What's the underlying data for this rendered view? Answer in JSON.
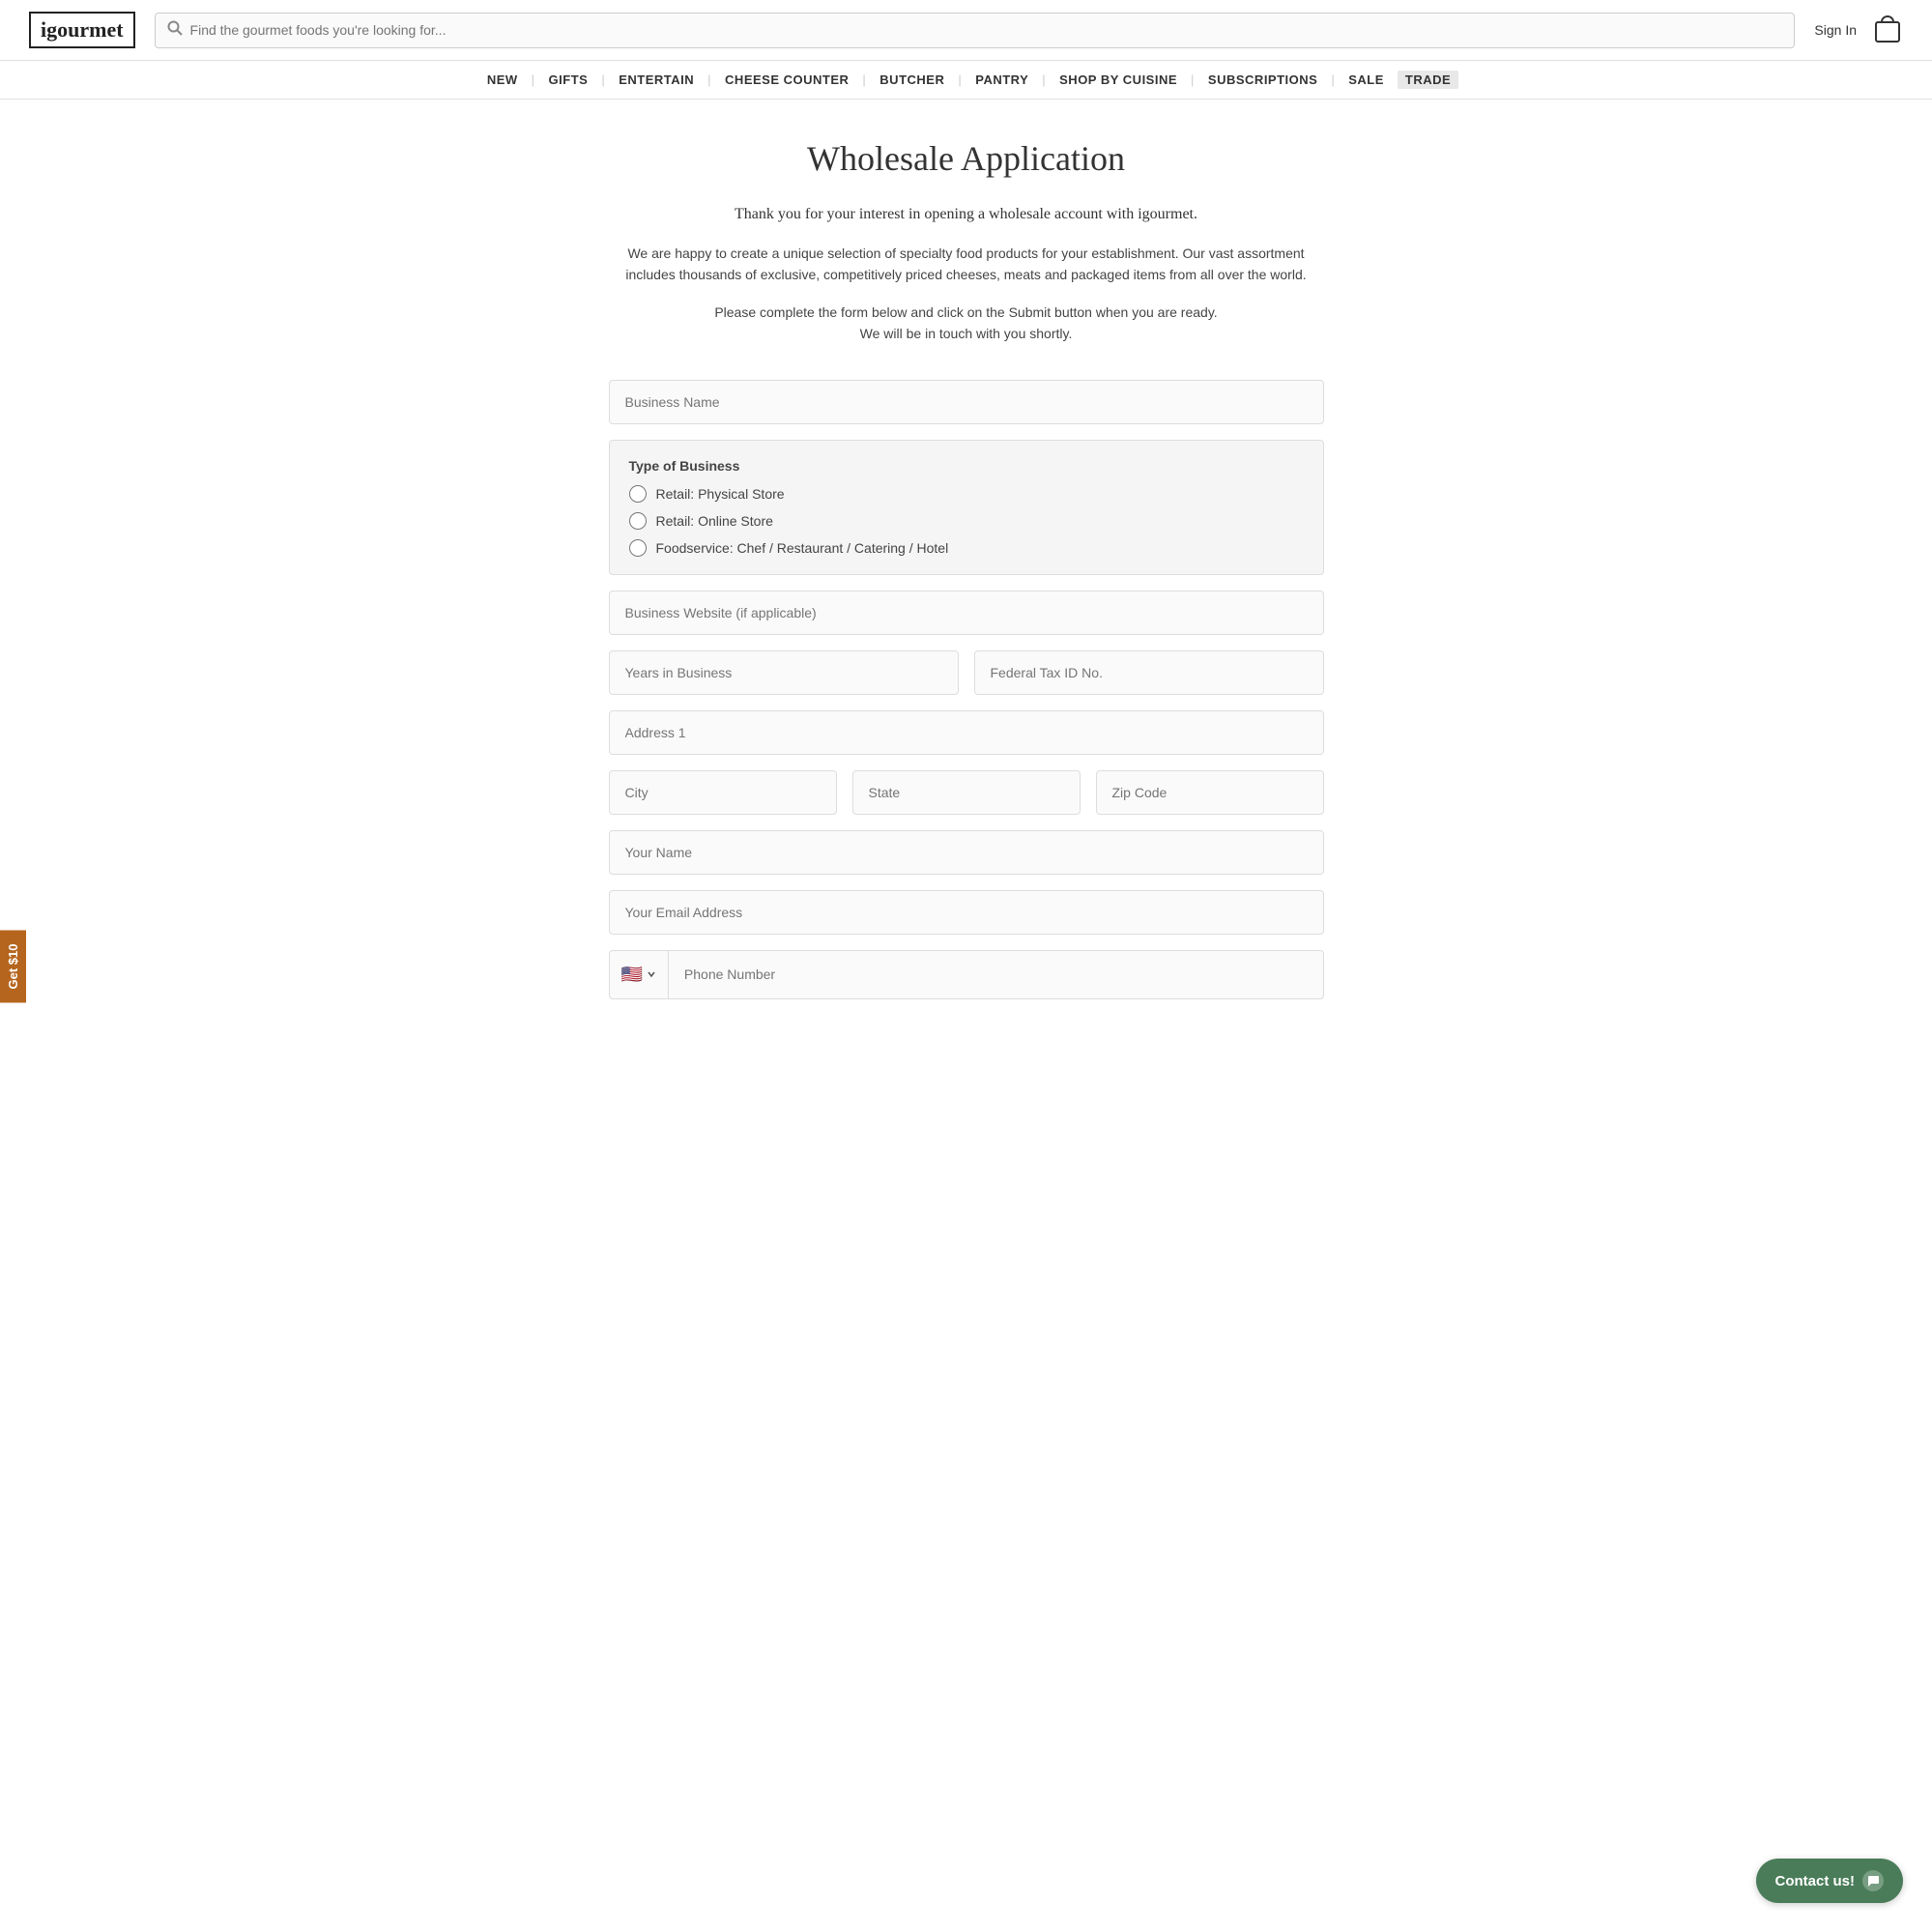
{
  "logo": {
    "text": "igourmet"
  },
  "search": {
    "placeholder": "Find the gourmet foods you're looking for..."
  },
  "header": {
    "sign_in": "Sign In"
  },
  "nav": {
    "items": [
      {
        "label": "NEW",
        "id": "new"
      },
      {
        "label": "GIFTS",
        "id": "gifts"
      },
      {
        "label": "ENTERTAIN",
        "id": "entertain"
      },
      {
        "label": "CHEESE COUNTER",
        "id": "cheese-counter"
      },
      {
        "label": "BUTCHER",
        "id": "butcher"
      },
      {
        "label": "PANTRY",
        "id": "pantry"
      },
      {
        "label": "SHOP BY CUISINE",
        "id": "shop-by-cuisine"
      },
      {
        "label": "SUBSCRIPTIONS",
        "id": "subscriptions"
      },
      {
        "label": "SALE",
        "id": "sale"
      },
      {
        "label": "TRADE",
        "id": "trade"
      }
    ]
  },
  "side_tab": {
    "label": "Get $10"
  },
  "page": {
    "title": "Wholesale Application",
    "intro": "Thank you for your interest in opening a wholesale account with igourmet.",
    "description": "We are happy to create a unique selection of specialty food products for your establishment. Our vast assortment includes thousands of exclusive, competitively priced cheeses, meats and packaged items from all over the world.",
    "form_note_line1": "Please complete the form below and click on the Submit button when you are ready.",
    "form_note_line2": "We will be in touch with you shortly."
  },
  "form": {
    "business_name_placeholder": "Business Name",
    "type_of_business_label": "Type of Business",
    "radio_options": [
      {
        "label": "Retail: Physical Store",
        "id": "retail-physical"
      },
      {
        "label": "Retail: Online Store",
        "id": "retail-online"
      },
      {
        "label": "Foodservice: Chef / Restaurant / Catering / Hotel",
        "id": "foodservice"
      }
    ],
    "website_placeholder": "Business Website (if applicable)",
    "years_in_business_placeholder": "Years in Business",
    "federal_tax_placeholder": "Federal Tax ID No.",
    "address1_placeholder": "Address 1",
    "city_placeholder": "City",
    "state_placeholder": "State",
    "zip_placeholder": "Zip Code",
    "your_name_placeholder": "Your Name",
    "email_placeholder": "Your Email Address",
    "phone_placeholder": "Phone Number"
  },
  "contact_btn": {
    "label": "Contact us!"
  }
}
